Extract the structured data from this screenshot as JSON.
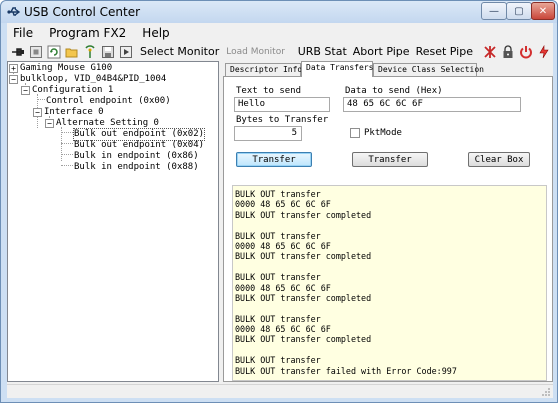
{
  "window": {
    "title": "USB Control Center",
    "icon": "usb-icon",
    "controls": {
      "minimize": "—",
      "maximize": "▢",
      "close": "✕"
    }
  },
  "menubar": {
    "items": [
      "File",
      "Program FX2",
      "Help"
    ]
  },
  "toolbar": {
    "icons": [
      "usb-connect-icon",
      "stop-icon",
      "refresh-icon",
      "open-folder-icon",
      "antenna-icon",
      "save-icon",
      "run-icon"
    ],
    "select_monitor": "Select Monitor",
    "load_monitor": "Load Monitor",
    "urb_stat": "URB Stat",
    "abort_pipe": "Abort Pipe",
    "reset_pipe": "Reset Pipe",
    "right_icons": [
      "reset-device-icon",
      "lock-icon",
      "power-icon",
      "plug-icon"
    ]
  },
  "tree": {
    "items": [
      {
        "label": "Gaming Mouse G100",
        "toggle": "+"
      },
      {
        "label": "bulkloop, VID_04B4&PID_1004",
        "toggle": "−"
      },
      {
        "label": "Configuration 1",
        "toggle": "−"
      },
      {
        "label": "Control endpoint (0x00)",
        "toggle": ""
      },
      {
        "label": "Interface 0",
        "toggle": "−"
      },
      {
        "label": "Alternate Setting 0",
        "toggle": "−"
      },
      {
        "label": "Bulk out endpoint (0x02)",
        "toggle": ""
      },
      {
        "label": "Bulk out endpoint (0x04)",
        "toggle": ""
      },
      {
        "label": "Bulk in endpoint (0x86)",
        "toggle": ""
      },
      {
        "label": "Bulk in endpoint (0x88)",
        "toggle": ""
      }
    ],
    "selected_index": 6
  },
  "tabs": {
    "items": [
      "Descriptor Info",
      "Data Transfers",
      "Device Class Selection"
    ],
    "active_index": 1
  },
  "transfers": {
    "text_to_send_label": "Text to send",
    "text_to_send_value": "Hello",
    "data_to_send_label": "Data to send (Hex)",
    "data_to_send_value": "48 65 6C 6C 6F",
    "bytes_label": "Bytes to Transfer",
    "bytes_value": "5",
    "pktmode_label": "PktMode",
    "pktmode_checked": false,
    "transfer_button_1": "Transfer",
    "transfer_button_2": "Transfer",
    "clear_box_button": "Clear Box"
  },
  "log": {
    "lines": [
      "BULK OUT transfer",
      "0000 48 65 6C 6C 6F",
      "BULK OUT transfer completed",
      "",
      "BULK OUT transfer",
      "0000 48 65 6C 6C 6F",
      "BULK OUT transfer completed",
      "",
      "BULK OUT transfer",
      "0000 48 65 6C 6C 6F",
      "BULK OUT transfer completed",
      "",
      "BULK OUT transfer",
      "0000 48 65 6C 6C 6F",
      "BULK OUT transfer completed",
      "",
      "BULK OUT transfer",
      "BULK OUT transfer failed with Error Code:997"
    ]
  },
  "colors": {
    "log_background": "#ffffe1",
    "frame": "#cddff3",
    "selection": "#3399ff"
  }
}
